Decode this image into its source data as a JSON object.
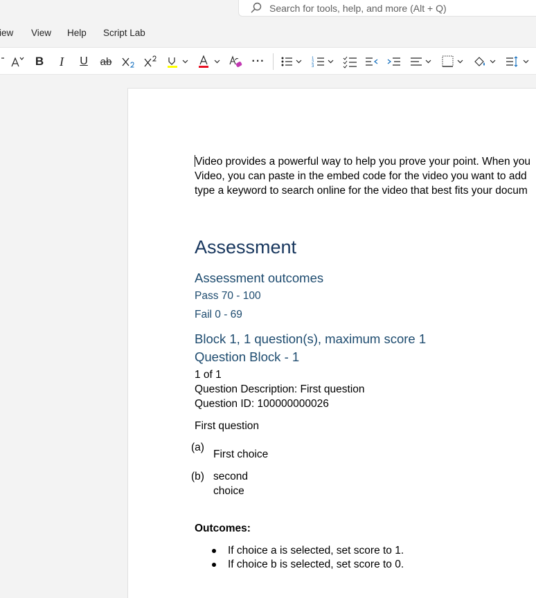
{
  "search": {
    "placeholder": "Search for tools, help, and more (Alt + Q)"
  },
  "menu": {
    "items": [
      "iew",
      "View",
      "Help",
      "Script Lab"
    ]
  },
  "ribbon": {
    "buttons": [
      "font-size-increase",
      "bold",
      "italic",
      "underline",
      "strikethrough",
      "subscript",
      "superscript",
      "highlight",
      "font-color",
      "clear-formatting",
      "more",
      "bullets",
      "numbering",
      "checklist",
      "decrease-indent",
      "increase-indent",
      "align",
      "borders",
      "shading",
      "line-spacing"
    ],
    "bold_label": "B",
    "italic_label": "I",
    "underline_label": "U",
    "strike_label": "ab",
    "more_label": "···",
    "font_color": "#e81123",
    "highlight_color": "#ffff00"
  },
  "document": {
    "intro_lines": [
      "Video provides a powerful way to help you prove your point. When you",
      "Video, you can paste in the embed code for the video you want to add",
      "type a keyword to search online for the video that best fits your docum"
    ],
    "heading": "Assessment",
    "outcomes_heading": "Assessment outcomes",
    "pass": "Pass 70 - 100",
    "fail": "Fail 0 - 69",
    "block_heading": "Block 1, 1 question(s), maximum score 1",
    "question_block": "Question Block - 1",
    "count": "1 of 1",
    "description": "Question Description: First question",
    "question_id": "Question ID: 100000000026",
    "question_text": "First question",
    "choices": [
      {
        "label": "(a)",
        "text": "First choice"
      },
      {
        "label": "(b)",
        "text_line1": "second",
        "text_line2": "choice"
      }
    ],
    "outcomes_label": "Outcomes:",
    "outcome_items": [
      "If choice a is selected, set score to 1.",
      "If choice b is selected, set score to 0."
    ]
  }
}
